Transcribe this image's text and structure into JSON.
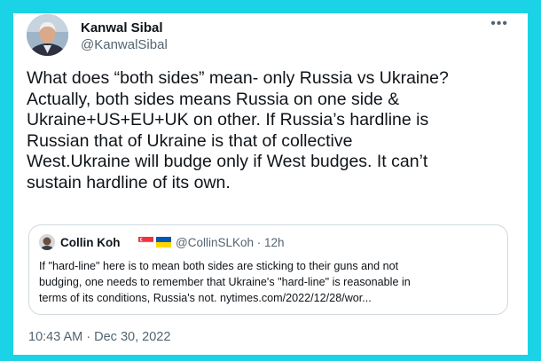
{
  "tweet": {
    "author_name": "Kanwal Sibal",
    "author_handle": "@KanwalSibal",
    "more_icon": "more-horizontal-icon",
    "text": "What does “both sides” mean- only Russia vs Ukraine?\nActually, both sides means Russia on one side &\nUkraine+US+EU+UK on other. If Russia’s hardline is\nRussian that of Ukraine is that of collective\nWest.Ukraine will budge only if West budges. It can’t\nsustain hardline of its own.",
    "timestamp": "10:43 AM · Dec 30, 2022"
  },
  "quoted": {
    "author_name": "Collin Koh",
    "flags": [
      "singapore-flag-icon",
      "ukraine-flag-icon"
    ],
    "handle_time": "@CollinSLKoh · 12h",
    "text": "If \"hard-line\" here is to mean both sides are sticking to their guns and not\nbudging, one needs to remember that Ukraine's \"hard-line\" is reasonable in\nterms of its conditions, Russia's not. nytimes.com/2022/12/28/wor..."
  },
  "colors": {
    "background": "#1ad3e6",
    "card": "#ffffff",
    "primary_text": "#0f1419",
    "secondary_text": "#536471",
    "border": "#cfd9de"
  }
}
